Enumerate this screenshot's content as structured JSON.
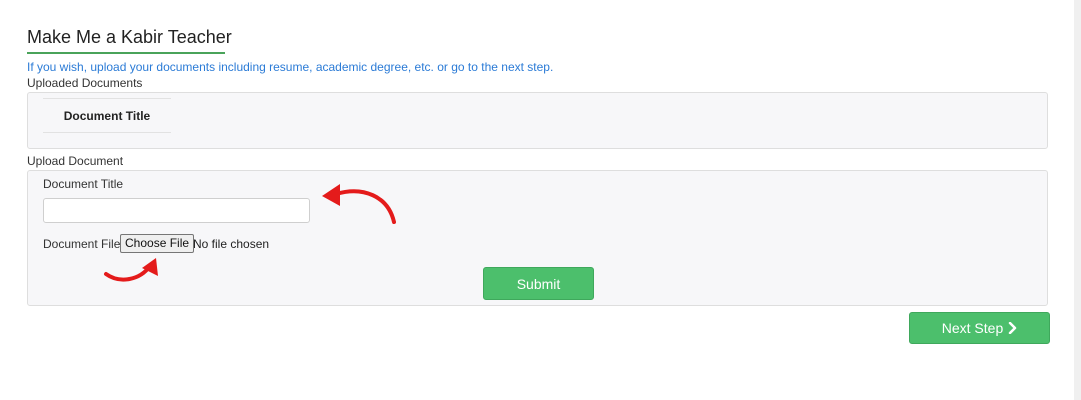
{
  "header": {
    "title": "Make Me a Kabir Teacher",
    "hint": "If you wish, upload your documents including resume, academic degree, etc. or go to the next step."
  },
  "uploaded": {
    "label": "Uploaded Documents",
    "column_header": "Document Title"
  },
  "upload": {
    "label": "Upload Document",
    "title_label": "Document Title",
    "title_value": "",
    "file_label": "Document File",
    "file_button": "Choose File",
    "file_status": "No file chosen",
    "submit_label": "Submit"
  },
  "footer": {
    "next_label": "Next Step",
    "next_icon": "chevron-right-icon"
  },
  "colors": {
    "accent": "#4cbf6c",
    "link": "#2b7bd6",
    "annotation_arrow": "#e41b1b"
  }
}
